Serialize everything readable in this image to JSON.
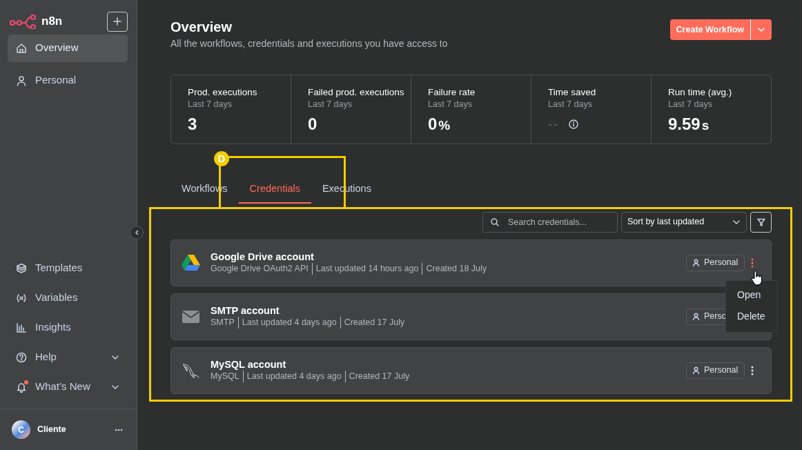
{
  "sidebar": {
    "logo": "n8n",
    "items": [
      {
        "label": "Overview",
        "kind": "home",
        "selected": true
      },
      {
        "label": "Personal",
        "kind": "user",
        "selected": false
      }
    ],
    "bottom_items": [
      {
        "label": "Templates",
        "kind": "box",
        "expandable": false,
        "notification": false
      },
      {
        "label": "Variables",
        "kind": "variable",
        "expandable": false,
        "notification": false
      },
      {
        "label": "Insights",
        "kind": "chart",
        "expandable": false,
        "notification": false
      },
      {
        "label": "Help",
        "kind": "help",
        "expandable": true,
        "notification": false
      },
      {
        "label": "What’s New",
        "kind": "bell",
        "expandable": true,
        "notification": true
      }
    ],
    "user": {
      "initial": "C",
      "name": "Cliente"
    }
  },
  "header": {
    "title": "Overview",
    "subtitle": "All the workflows, credentials and executions you have access to",
    "create_button": "Create Workflow"
  },
  "stats": [
    {
      "title": "Prod. executions",
      "period": "Last 7 days",
      "value": "3",
      "muted": false,
      "info": false
    },
    {
      "title": "Failed prod. executions",
      "period": "Last 7 days",
      "value": "0",
      "muted": false,
      "info": false
    },
    {
      "title": "Failure rate",
      "period": "Last 7 days",
      "value": "0",
      "unit": "%",
      "muted": false,
      "info": false
    },
    {
      "title": "Time saved",
      "period": "Last 7 days",
      "value": "--",
      "muted": true,
      "info": true
    },
    {
      "title": "Run time (avg.)",
      "period": "Last 7 days",
      "value": "9.59",
      "unit": "s",
      "muted": false,
      "info": false
    }
  ],
  "tabs": [
    {
      "label": "Workflows",
      "selected": false
    },
    {
      "label": "Credentials",
      "selected": true
    },
    {
      "label": "Executions",
      "selected": false
    }
  ],
  "toolbar": {
    "search_placeholder": "Search credentials...",
    "sort": "Sort by last updated"
  },
  "credentials": [
    {
      "name": "Google Drive account",
      "kind": "gdrive",
      "details": [
        "Google Drive OAuth2 API",
        "Last updated 14 hours ago",
        "Created 18 July"
      ],
      "owner": "Personal",
      "menu_open": true,
      "menu_items": [
        "Open",
        "Delete"
      ]
    },
    {
      "name": "SMTP account",
      "kind": "mail",
      "details": [
        "SMTP",
        "Last updated 4 days ago",
        "Created 17 July"
      ],
      "owner": "Perso",
      "menu_open": false
    },
    {
      "name": "MySQL account",
      "kind": "mysql",
      "details": [
        "MySQL",
        "Last updated 4 days ago",
        "Created 17 July"
      ],
      "owner": "Personal",
      "menu_open": false
    }
  ],
  "annotation": {
    "label": "D"
  }
}
